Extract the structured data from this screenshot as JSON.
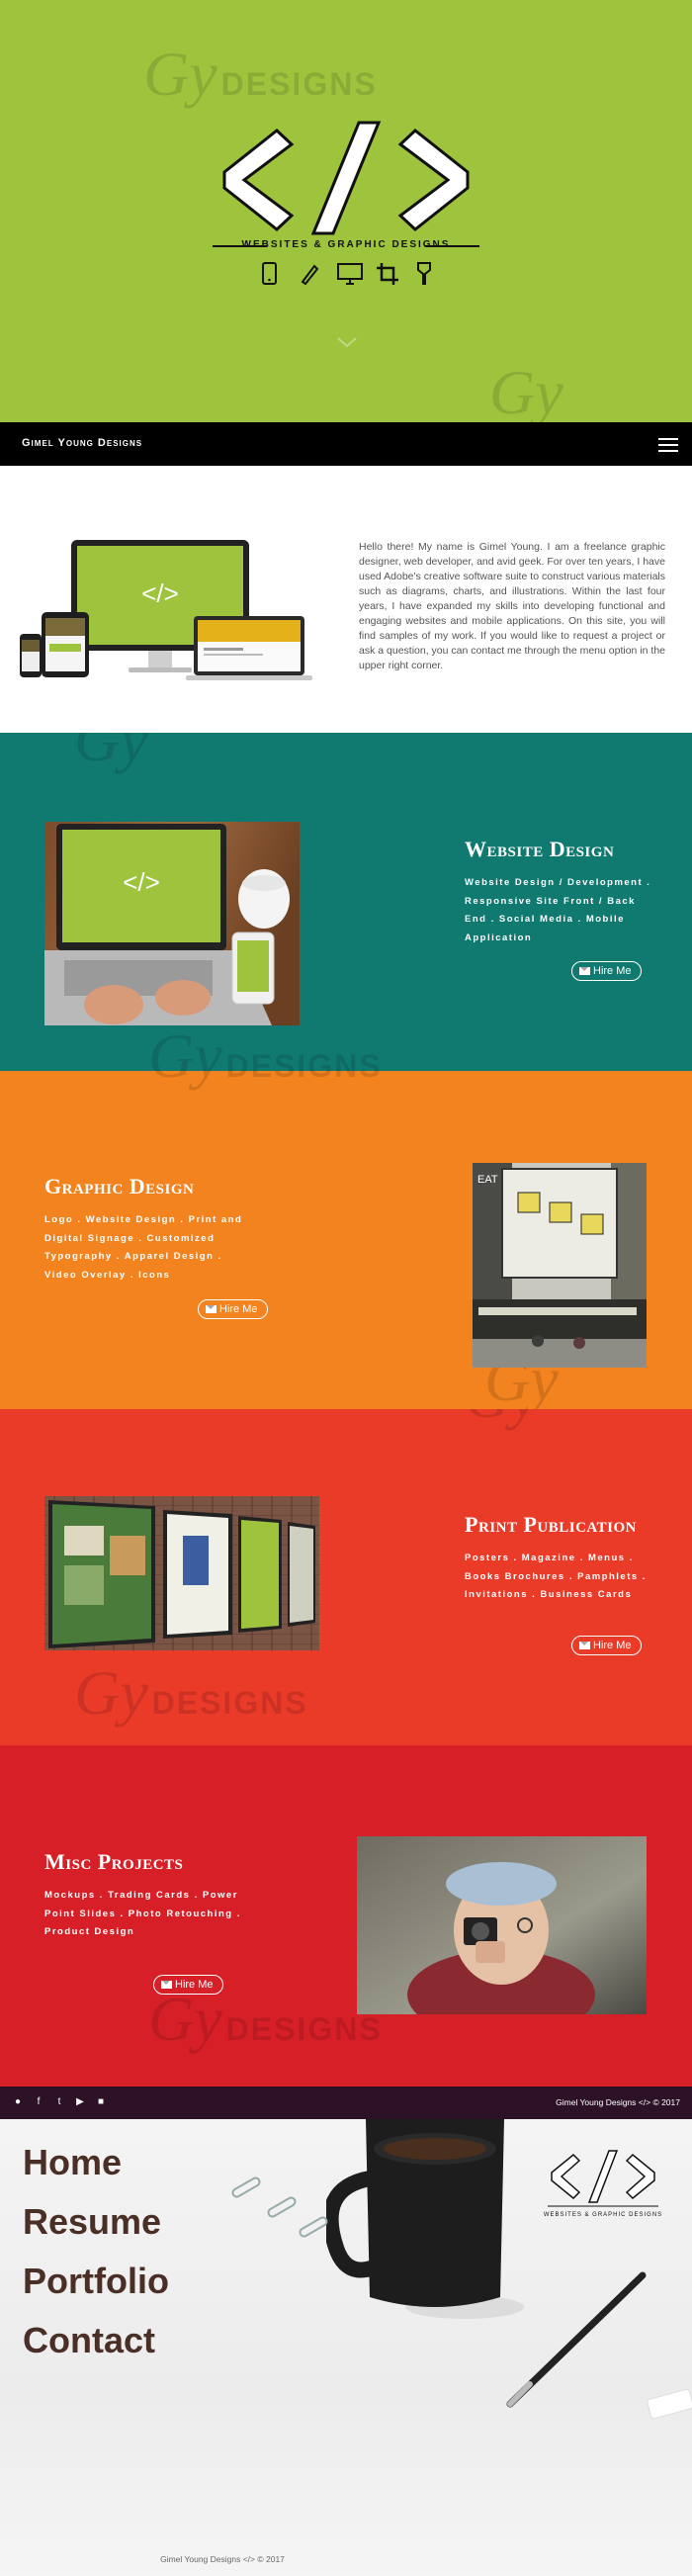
{
  "hero": {
    "logo_symbol": "</>",
    "tagline": "WEBSITES & GRAPHIC DESIGNS",
    "watermark_letters": "Gy",
    "watermark_word": "DESIGNS",
    "tool_icons": [
      "mobile-icon",
      "pen-icon",
      "monitor-icon",
      "crop-icon",
      "brush-icon"
    ]
  },
  "navbar": {
    "brand": "Gimel Young Designs"
  },
  "intro": {
    "text": "Hello there! My name is Gimel Young. I am a freelance graphic designer, web developer, and avid geek. For over ten years, I have used Adobe's creative software suite to construct various materials such as diagrams, charts, and illustrations. Within the last four years, I have expanded my skills into developing functional and engaging websites and mobile applications. On this site, you will find samples of my work. If you would like to request a project or ask a question, you can contact me through the menu option in the upper right corner."
  },
  "services": {
    "web": {
      "title": "Website Design",
      "desc": "Website Design / Development . Responsive Site Front / Back End . Social Media . Mobile Application",
      "button": "Hire Me"
    },
    "graphic": {
      "title": "Graphic Design",
      "desc": "Logo . Website Design . Print and Digital Signage . Customized Typography . Apparel Design . Video Overlay . Icons",
      "button": "Hire Me"
    },
    "print": {
      "title": "Print Publication",
      "desc": "Posters . Magazine . Menus . Books Brochures . Pamphlets . Invitations . Business Cards",
      "button": "Hire Me"
    },
    "misc": {
      "title": "Misc Projects",
      "desc": "Mockups . Trading Cards . Power Point Slides . Photo Retouching . Product Design",
      "button": "Hire Me"
    }
  },
  "footer": {
    "social_icons": [
      "chat-icon",
      "facebook-icon",
      "twitter-icon",
      "youtube-icon",
      "game-icon"
    ],
    "social_glyphs": [
      "●",
      "f",
      "t",
      "▶",
      "■"
    ],
    "copyright_name": "Gimel Young Designs",
    "copyright_suffix": "© 2017"
  },
  "menu": {
    "items": [
      "Home",
      "Resume",
      "Portfolio",
      "Contact"
    ],
    "copyright": "Gimel Young Designs </> © 2017"
  },
  "colors": {
    "hero": "#9ec43d",
    "web": "#107a70",
    "graphic": "#f2831f",
    "print": "#ea3a28",
    "misc": "#d71f27",
    "footer": "#2d1227",
    "menu_text": "#4a2f27"
  }
}
